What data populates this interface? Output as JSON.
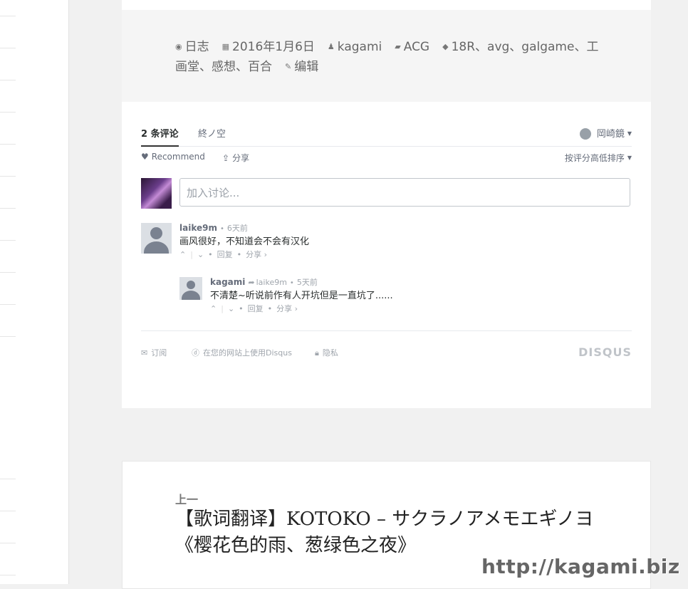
{
  "post_meta": {
    "items": [
      {
        "icon": "format-icon",
        "label": "日志"
      },
      {
        "icon": "calendar-icon",
        "label": "2016年1月6日"
      },
      {
        "icon": "user-icon",
        "label": "kagami"
      },
      {
        "icon": "folder-icon",
        "label": "ACG"
      },
      {
        "icon": "tag-icon",
        "label": "18R、avg、galgame、工画堂、感想、百合"
      },
      {
        "icon": "pencil-icon",
        "label": "编辑"
      }
    ]
  },
  "disqus": {
    "comment_count_tab": "2 条评论",
    "community_tab": "終ノ空",
    "user_name": "岡崎鏡",
    "recommend_label": "Recommend",
    "share_label": "分享",
    "sort_label": "按评分高低排序",
    "input_placeholder": "加入讨论...",
    "comments": [
      {
        "author": "laike9m",
        "time": "6天前",
        "text": "画风很好，不知道会不会有汉化",
        "reply": "回复",
        "share": "分享 ›"
      },
      {
        "author": "kagami",
        "reply_to": "laike9m",
        "time": "5天前",
        "text": "不清楚~听说前作有人开坑但是一直坑了......",
        "reply": "回复",
        "share": "分享 ›"
      }
    ],
    "footer": {
      "subscribe": "订阅",
      "add_disqus": "在您的网站上使用Disqus",
      "privacy": "隐私",
      "brand": "DISQUS"
    }
  },
  "prev_post": {
    "label": "上一",
    "title": "【歌词翻译】KOTOKO – サクラノアメモエギノヨ《樱花色的雨、葱绿色之夜》"
  },
  "watermark": "http://kagami.biz"
}
